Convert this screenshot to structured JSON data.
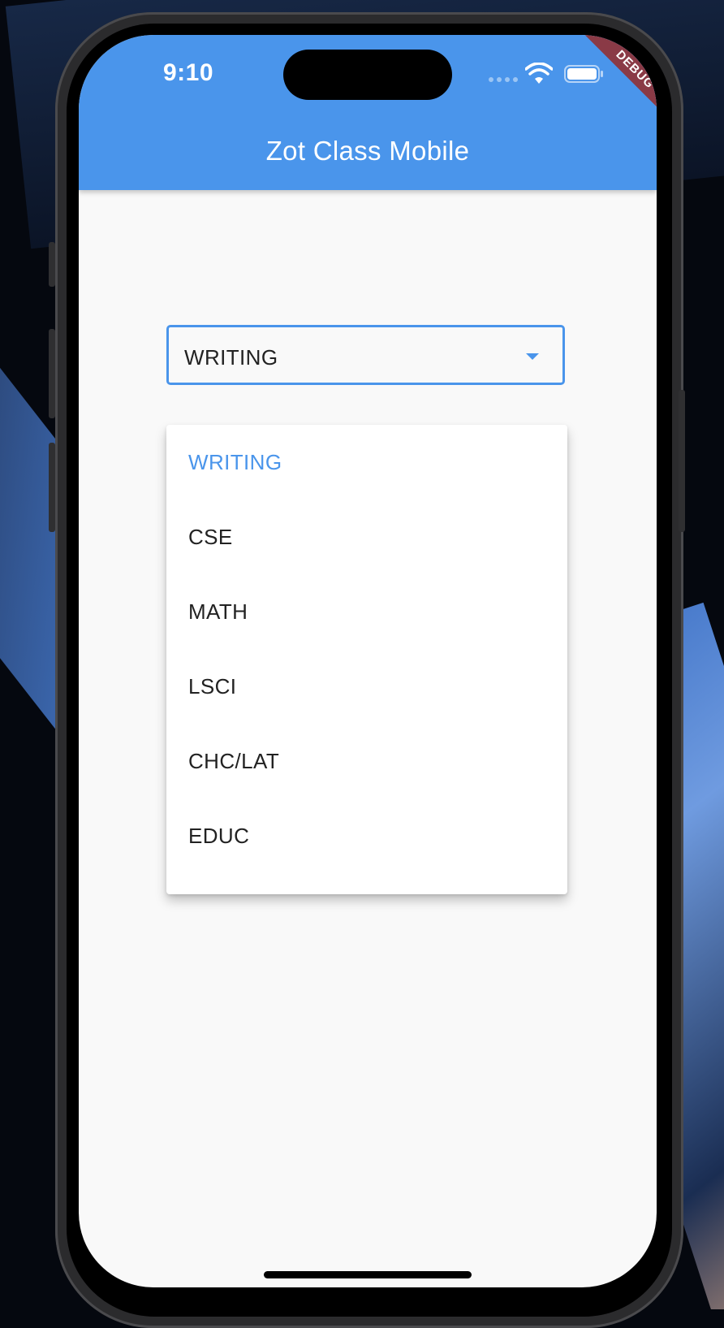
{
  "status_bar": {
    "time": "9:10",
    "icons": [
      "signal-icon",
      "wifi-icon",
      "battery-icon"
    ]
  },
  "debug_banner": "DEBUG",
  "app_bar": {
    "title": "Zot Class Mobile",
    "color": "#4a95eb"
  },
  "dropdown": {
    "selected_value": "WRITING",
    "icon": "caret-down-icon",
    "options": [
      {
        "label": "WRITING",
        "selected": true
      },
      {
        "label": "CSE",
        "selected": false
      },
      {
        "label": "MATH",
        "selected": false
      },
      {
        "label": "LSCI",
        "selected": false
      },
      {
        "label": "CHC/LAT",
        "selected": false
      },
      {
        "label": "EDUC",
        "selected": false
      }
    ]
  },
  "colors": {
    "accent": "#4a95eb",
    "debug_ribbon": "#8a3a46",
    "background": "#f9f9f9"
  }
}
